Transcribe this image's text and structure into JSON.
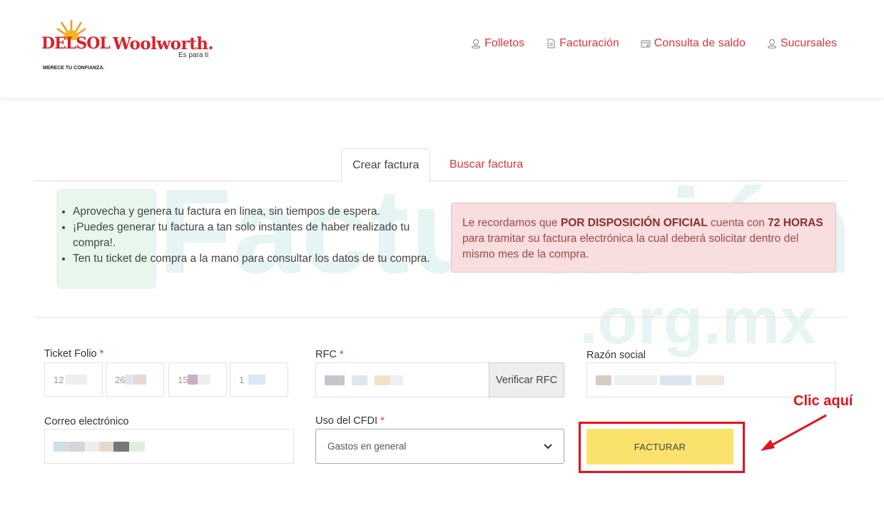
{
  "header": {
    "logo_delsol": {
      "brand": "DELSOL",
      "tagline": "MERECE TU CONFIANZA."
    },
    "logo_woolworth": {
      "brand": "Woolworth.",
      "tagline": "Es para ti"
    },
    "nav": [
      {
        "label": "Folletos",
        "icon": "location-pin-icon"
      },
      {
        "label": "Facturación",
        "icon": "document-icon"
      },
      {
        "label": "Consulta de saldo",
        "icon": "card-icon"
      },
      {
        "label": "Sucursales",
        "icon": "location-pin-icon"
      }
    ]
  },
  "tabs": {
    "create": "Crear factura",
    "search": "Buscar factura"
  },
  "watermark": {
    "main": "Facturación",
    "sub": ".org.mx"
  },
  "info": {
    "items": [
      "Aprovecha y genera tu factura en linea, sin tiempos de espera.",
      "¡Puedes generar tu factura a tan solo instantes de haber realizado tu compra!.",
      "Ten tu ticket de compra a la mano para consultar los datos de tu compra."
    ]
  },
  "alert": {
    "part1": "Le recordamos que ",
    "bold1": "POR DISPOSICIÓN OFICIAL",
    "part2": " cuenta con ",
    "bold2": "72 HORAS",
    "part3": " para tramitar su factura electrónica la cual deberá solicitar dentro del mismo mes de la compra."
  },
  "form": {
    "ticket_label": "Ticket Folio",
    "ticket_values": [
      "12",
      "26",
      "15",
      "1"
    ],
    "rfc_label": "RFC",
    "verify_label": "Verificar RFC",
    "razon_label": "Razón social",
    "email_label": "Correo electrónico",
    "cfdi_label": "Uso del CFDI",
    "cfdi_selected": "Gastos en general",
    "required_mark": "*",
    "submit_label": "FACTURAR"
  },
  "annotation": {
    "text": "Clic aquí",
    "color": "#e4121c"
  },
  "colors": {
    "brand_red": "#d9363e",
    "button_yellow": "#fae26d",
    "alert_bg": "#f8dede"
  }
}
